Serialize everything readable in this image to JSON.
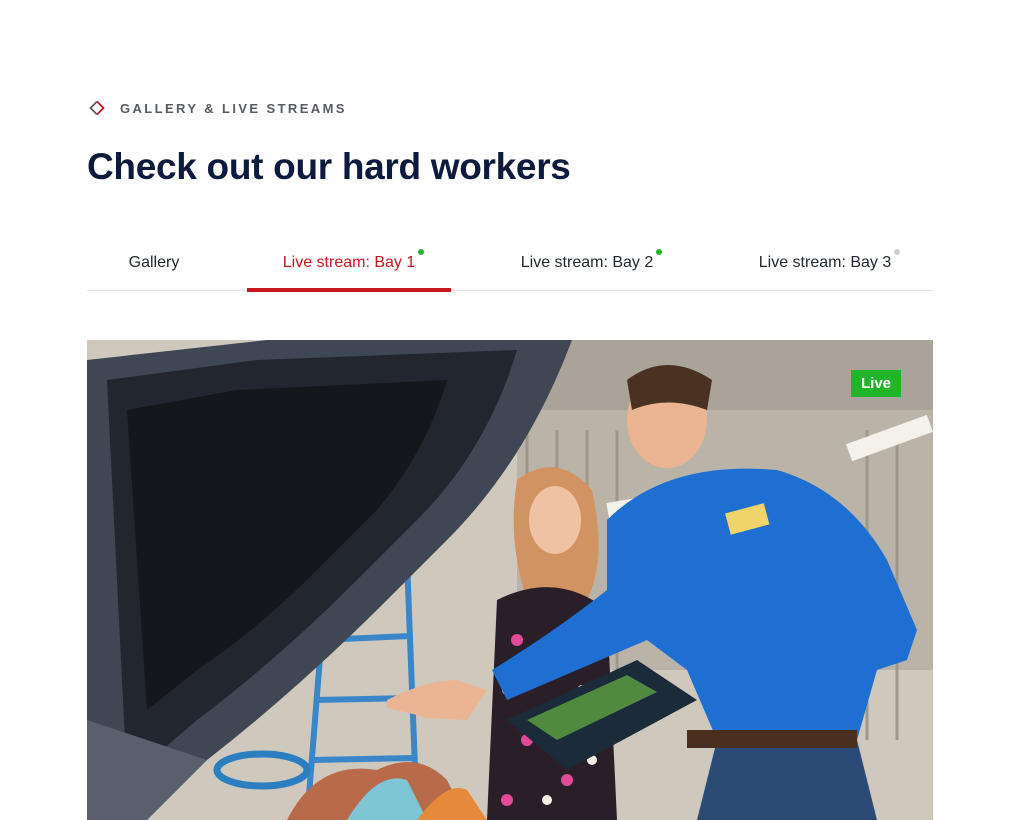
{
  "section": {
    "eyebrow": "GALLERY & LIVE STREAMS",
    "eyebrow_icon": "diamond-chevron-icon",
    "title": "Check out our hard workers"
  },
  "tabs": [
    {
      "label": "Gallery",
      "active": false,
      "status": null
    },
    {
      "label": "Live stream: Bay 1",
      "active": true,
      "status": "online",
      "status_color": "#21b52a"
    },
    {
      "label": "Live stream: Bay 2",
      "active": false,
      "status": "online",
      "status_color": "#21b52a"
    },
    {
      "label": "Live stream: Bay 3",
      "active": false,
      "status": "offline",
      "status_color": "#cfcfcf"
    }
  ],
  "stream": {
    "badge": "Live",
    "badge_color": "#21b52a",
    "image_subject": "mechanic in blue shirt showing clipboard to customer beside open car hood"
  },
  "colors": {
    "accent": "#c8161d",
    "heading": "#0c1a3d"
  }
}
